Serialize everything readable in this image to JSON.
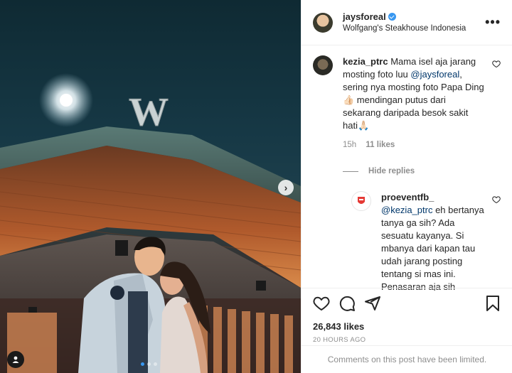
{
  "post_header": {
    "username": "jaysforeal",
    "location": "Wolfgang's Steakhouse Indonesia",
    "more_icon": "more-horizontal-icon"
  },
  "photo": {
    "sign_letter": "W",
    "carousel_index": 1,
    "carousel_count": 3
  },
  "comments": [
    {
      "username": "kezia_ptrc",
      "text_before": "Mama isel aja jarang mosting foto luu ",
      "mention": "@jaysforeal",
      "text_after": ", sering nya mosting foto Papa Ding👍🏻 mendingan putus dari sekarang daripada besok sakit hati🙏🏻",
      "time": "15h",
      "likes": "11 likes",
      "hide_replies_label": "Hide replies"
    }
  ],
  "reply": {
    "username": "proeventfb_",
    "mention": "@kezia_ptrc",
    "text": "eh bertanya tanya ga sih? Ada sesuatu kayanya. Si mbanya dari kapan tau udah jarang posting tentang si mas ini. Penasaran aja sih memang. Tp klo mmg ada tujuan baik tertentu ya sudah baik"
  },
  "actions": {
    "like_count": "26,843 likes",
    "timestamp": "20 HOURS AGO"
  },
  "footer": {
    "limited_message": "Comments on this post have been limited."
  },
  "colors": {
    "verified_blue": "#3897f0",
    "link_blue": "#00376b",
    "muted_gray": "#8e8e8e"
  }
}
